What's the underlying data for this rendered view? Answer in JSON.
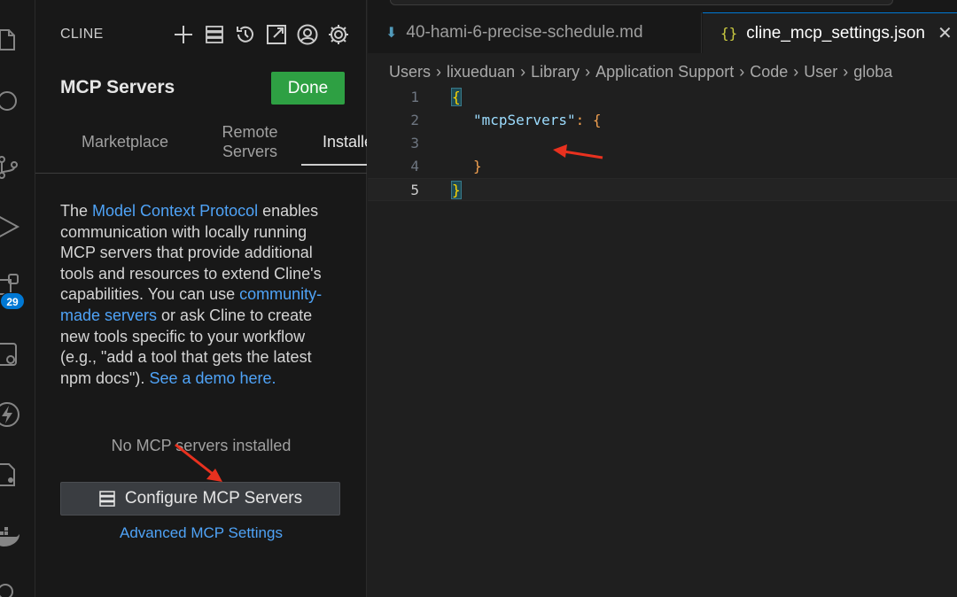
{
  "activity_bar": {
    "badge": "29",
    "icons": [
      "files-icon",
      "search-icon",
      "source-control-icon",
      "run-debug-icon",
      "extensions-icon",
      "remote-explorer-icon",
      "cline-icon",
      "testing-icon",
      "docker-icon",
      "account-icon"
    ]
  },
  "sidebar": {
    "header": "CLINE",
    "actions": [
      "plus-icon",
      "mcp-servers-icon",
      "history-icon",
      "popout-icon",
      "account-icon",
      "settings-icon"
    ],
    "title": "MCP Servers",
    "done_label": "Done",
    "tabs": [
      {
        "label": "Marketplace"
      },
      {
        "label": "Remote Servers"
      },
      {
        "label": "Installed"
      }
    ],
    "description": {
      "p1": "The ",
      "link1": "Model Context Protocol",
      "p2": " enables communication with locally running MCP servers that provide additional tools and resources to extend Cline's capabilities. You can use ",
      "link2": "community-made servers",
      "p3": " or ask Cline to create new tools specific to your workflow (e.g., \"add a tool that gets the latest npm docs\"). ",
      "link3": "See a demo here."
    },
    "empty_message": "No MCP servers installed",
    "configure_label": "Configure MCP Servers",
    "advanced_label": "Advanced MCP Settings"
  },
  "editor": {
    "tabs": [
      {
        "label": "40-hami-6-precise-schedule.md",
        "icon": "markdown-icon"
      },
      {
        "label": "cline_mcp_settings.json",
        "icon": "{}"
      }
    ],
    "breadcrumb": [
      "Users",
      "lixueduan",
      "Library",
      "Application Support",
      "Code",
      "User",
      "globa"
    ],
    "lines": [
      {
        "n": "1",
        "text": "{"
      },
      {
        "n": "2",
        "key": "\"mcpServers\"",
        "rest": ": {"
      },
      {
        "n": "3",
        "text": ""
      },
      {
        "n": "4",
        "text": "}"
      },
      {
        "n": "5",
        "text": "}"
      }
    ]
  },
  "colors": {
    "accent": "#0078d4",
    "done_button": "#2ea043",
    "link": "#4fa3f7",
    "annotation_arrow": "#e8311f"
  }
}
